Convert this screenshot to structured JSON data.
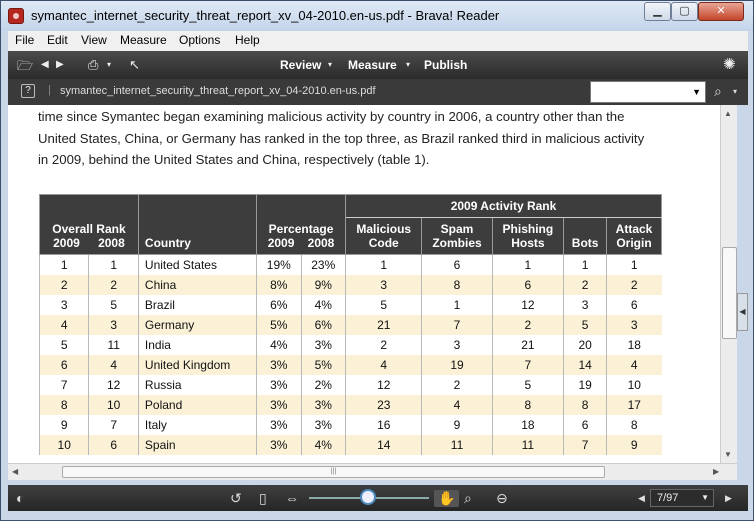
{
  "window": {
    "title": "symantec_internet_security_threat_report_xv_04-2010.en-us.pdf - Brava! Reader",
    "min_icon": "minimize-icon",
    "max_icon": "maximize-icon",
    "close_icon": "close-icon"
  },
  "menu": {
    "items": [
      {
        "label": "File"
      },
      {
        "label": "Edit"
      },
      {
        "label": "View"
      },
      {
        "label": "Measure"
      },
      {
        "label": "Options"
      },
      {
        "label": "Help"
      }
    ]
  },
  "toolbar": {
    "review": "Review",
    "measure": "Measure",
    "publish": "Publish"
  },
  "docbar": {
    "help": "?",
    "separator": "|",
    "filename": "symantec_internet_security_threat_report_xv_04-2010.en-us.pdf",
    "search_value": ""
  },
  "document": {
    "lines": [
      "time since Symantec began examining malicious activity by country in 2006, a country other than the",
      "United States, China, or Germany has ranked in the top three, as Brazil ranked third in malicious activity",
      "in 2009, behind the United States and China, respectively (table 1)."
    ],
    "table": {
      "group_header": "2009 Activity Rank",
      "headers": {
        "overall_rank": "Overall Rank",
        "y2009": "2009",
        "y2008": "2008",
        "country": "Country",
        "percentage": "Percentage",
        "malicious_code_1": "Malicious",
        "malicious_code_2": "Code",
        "spam_zombies_1": "Spam",
        "spam_zombies_2": "Zombies",
        "phishing_hosts_1": "Phishing",
        "phishing_hosts_2": "Hosts",
        "bots": "Bots",
        "attack_origin_1": "Attack",
        "attack_origin_2": "Origin"
      },
      "rows": [
        [
          "1",
          "1",
          "United States",
          "19%",
          "23%",
          "1",
          "6",
          "1",
          "1",
          "1"
        ],
        [
          "2",
          "2",
          "China",
          "8%",
          "9%",
          "3",
          "8",
          "6",
          "2",
          "2"
        ],
        [
          "3",
          "5",
          "Brazil",
          "6%",
          "4%",
          "5",
          "1",
          "12",
          "3",
          "6"
        ],
        [
          "4",
          "3",
          "Germany",
          "5%",
          "6%",
          "21",
          "7",
          "2",
          "5",
          "3"
        ],
        [
          "5",
          "11",
          "India",
          "4%",
          "3%",
          "2",
          "3",
          "21",
          "20",
          "18"
        ],
        [
          "6",
          "4",
          "United Kingdom",
          "3%",
          "5%",
          "4",
          "19",
          "7",
          "14",
          "4"
        ],
        [
          "7",
          "12",
          "Russia",
          "3%",
          "2%",
          "12",
          "2",
          "5",
          "19",
          "10"
        ],
        [
          "8",
          "10",
          "Poland",
          "3%",
          "3%",
          "23",
          "4",
          "8",
          "8",
          "17"
        ],
        [
          "9",
          "7",
          "Italy",
          "3%",
          "3%",
          "16",
          "9",
          "18",
          "6",
          "8"
        ],
        [
          "10",
          "6",
          "Spain",
          "3%",
          "4%",
          "14",
          "11",
          "11",
          "7",
          "9"
        ]
      ]
    }
  },
  "statusbar": {
    "page": "7/97"
  },
  "colors": {
    "header_bg": "#3d3d3d",
    "row_alt": "#fbf1d6",
    "toolbar": "#2b2b2b"
  }
}
